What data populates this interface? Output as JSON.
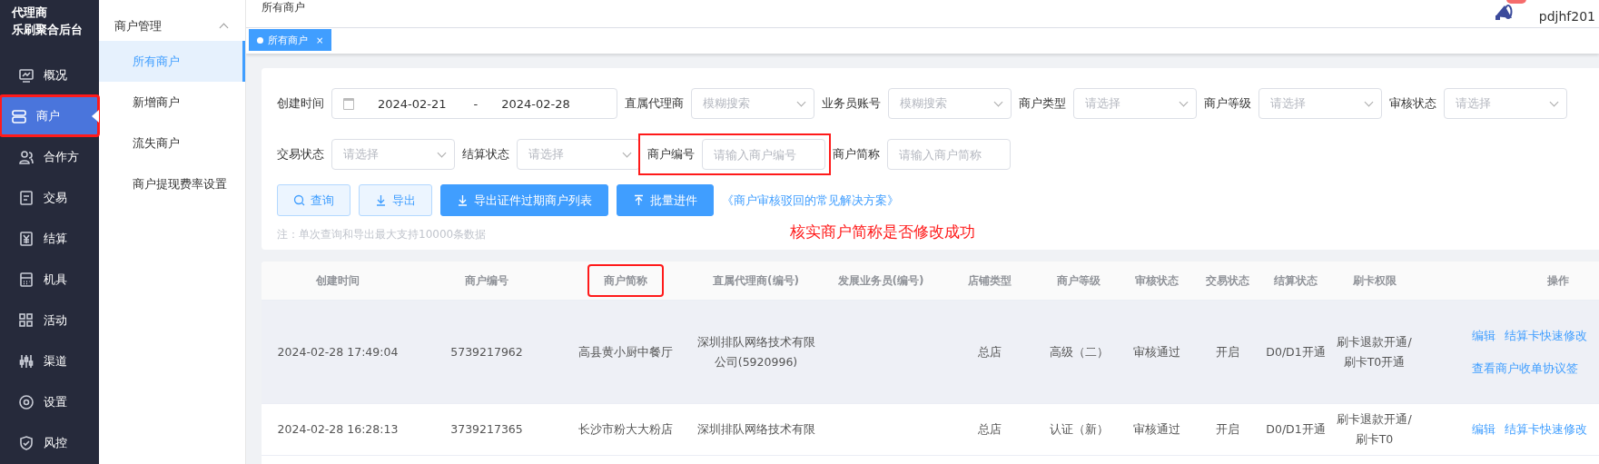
{
  "sidebar": {
    "logo_lines": [
      "代理商",
      "乐刷聚合后台"
    ],
    "items": [
      {
        "label": "概况",
        "kind": "overview",
        "selected": false,
        "highlighted": false
      },
      {
        "label": "商户",
        "kind": "merchant",
        "selected": true,
        "highlighted": true
      },
      {
        "label": "合作方",
        "kind": "partner",
        "selected": false,
        "highlighted": false
      },
      {
        "label": "交易",
        "kind": "trade",
        "selected": false,
        "highlighted": false
      },
      {
        "label": "结算",
        "kind": "settlement",
        "selected": false,
        "highlighted": false
      },
      {
        "label": "机具",
        "kind": "device",
        "selected": false,
        "highlighted": false
      },
      {
        "label": "活动",
        "kind": "activity",
        "selected": false,
        "highlighted": false
      },
      {
        "label": "渠道",
        "kind": "channel",
        "selected": false,
        "highlighted": false
      },
      {
        "label": "设置",
        "kind": "settings",
        "selected": false,
        "highlighted": false
      },
      {
        "label": "风控",
        "kind": "risk",
        "selected": false,
        "highlighted": false
      }
    ]
  },
  "submenu": {
    "title": "商户管理",
    "expanded": true,
    "items": [
      {
        "label": "所有商户",
        "selected": true
      },
      {
        "label": "新增商户",
        "selected": false
      },
      {
        "label": "流失商户",
        "selected": false
      },
      {
        "label": "商户提现费率设置",
        "selected": false
      }
    ]
  },
  "header": {
    "breadcrumb": "所有商户",
    "username": "pdjhf201"
  },
  "tabs": [
    {
      "label": "所有商户",
      "selected": true,
      "close": "×"
    }
  ],
  "filters": [
    {
      "kind": "daterange",
      "label": "创建时间",
      "start": "2024-02-21",
      "separator": "-",
      "end": "2024-02-28",
      "highlighted": false
    },
    {
      "kind": "select",
      "label": "直属代理商",
      "placeholder": "模糊搜索",
      "highlighted": false
    },
    {
      "kind": "select",
      "label": "业务员账号",
      "placeholder": "模糊搜索",
      "highlighted": false
    },
    {
      "kind": "select",
      "label": "商户类型",
      "placeholder": "请选择",
      "highlighted": false
    },
    {
      "kind": "select",
      "label": "商户等级",
      "placeholder": "请选择",
      "highlighted": false
    },
    {
      "kind": "select",
      "label": "审核状态",
      "placeholder": "请选择",
      "highlighted": false
    },
    {
      "kind": "select",
      "label": "交易状态",
      "placeholder": "请选择",
      "highlighted": false
    },
    {
      "kind": "select",
      "label": "结算状态",
      "placeholder": "请选择",
      "highlighted": false
    },
    {
      "kind": "input",
      "label": "商户编号",
      "placeholder": "请输入商户编号",
      "highlighted": true
    },
    {
      "kind": "input",
      "label": "商户简称",
      "placeholder": "请输入商户简称",
      "highlighted": false
    }
  ],
  "actions": [
    {
      "kind": "query",
      "label": "查询"
    },
    {
      "kind": "export",
      "label": "导出"
    },
    {
      "kind": "export_primary",
      "label": "导出证件过期商户列表"
    },
    {
      "kind": "upload_primary",
      "label": "批量进件"
    },
    {
      "kind": "link",
      "label": "《商户审核驳回的常见解决方案》"
    }
  ],
  "note": "注：单次查询和导出最大支持10000条数据",
  "annotation": "核实商户简称是否修改成功",
  "table": {
    "columns": [
      {
        "label": "创建时间",
        "highlighted": false
      },
      {
        "label": "商户编号",
        "highlighted": false
      },
      {
        "label": "商户简称",
        "highlighted": true
      },
      {
        "label": "直属代理商(编号)",
        "highlighted": false
      },
      {
        "label": "发展业务员(编号)",
        "highlighted": false
      },
      {
        "label": "店铺类型",
        "highlighted": false
      },
      {
        "label": "商户等级",
        "highlighted": false
      },
      {
        "label": "审核状态",
        "highlighted": false
      },
      {
        "label": "交易状态",
        "highlighted": false
      },
      {
        "label": "结算状态",
        "highlighted": false
      },
      {
        "label": "刷卡权限",
        "highlighted": false
      },
      {
        "label": "操作",
        "highlighted": false
      }
    ],
    "rows": [
      {
        "hovered": true,
        "cells": [
          "2024-02-28 17:49:04",
          "5739217962",
          "高县黄小厨中餐厅",
          "深圳排队网络技术有限公司(5920996)",
          "",
          "总店",
          "高级（二）",
          "审核通过",
          "开启",
          "D0/D1开通",
          "刷卡退款开通/ 刷卡T0开通"
        ],
        "actions": [
          "编辑",
          "结算卡快速修改",
          "查看商户收单协议签"
        ]
      },
      {
        "hovered": false,
        "cells": [
          "2024-02-28 16:28:13",
          "3739217365",
          "长沙市粉大大粉店",
          "深圳排队网络技术有限",
          "",
          "总店",
          "认证（新）",
          "审核通过",
          "开启",
          "D0/D1开通",
          "刷卡退款开通/ 刷卡T0"
        ],
        "actions": [
          "编辑",
          "结算卡快速修改"
        ]
      }
    ]
  }
}
